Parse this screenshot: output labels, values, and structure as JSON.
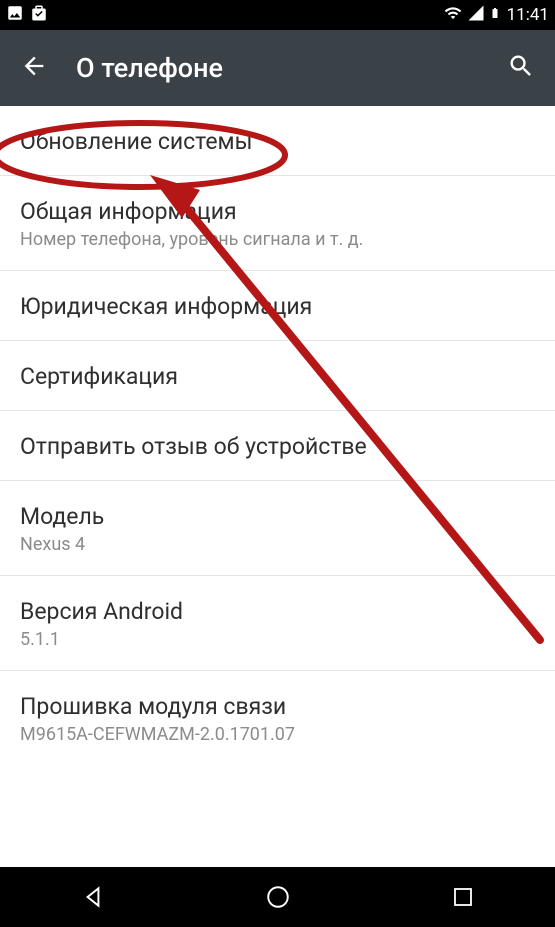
{
  "status": {
    "time": "11:41"
  },
  "header": {
    "title": "О телефоне"
  },
  "items": [
    {
      "title": "Обновление системы",
      "subtitle": null
    },
    {
      "title": "Общая информация",
      "subtitle": "Номер телефона, уровень сигнала и т. д."
    },
    {
      "title": "Юридическая информация",
      "subtitle": null
    },
    {
      "title": "Сертификация",
      "subtitle": null
    },
    {
      "title": "Отправить отзыв об устройстве",
      "subtitle": null
    },
    {
      "title": "Модель",
      "subtitle": "Nexus 4"
    },
    {
      "title": "Версия Android",
      "subtitle": "5.1.1"
    },
    {
      "title": "Прошивка модуля связи",
      "subtitle": "M9615A-CEFWMAZM-2.0.1701.07"
    }
  ]
}
